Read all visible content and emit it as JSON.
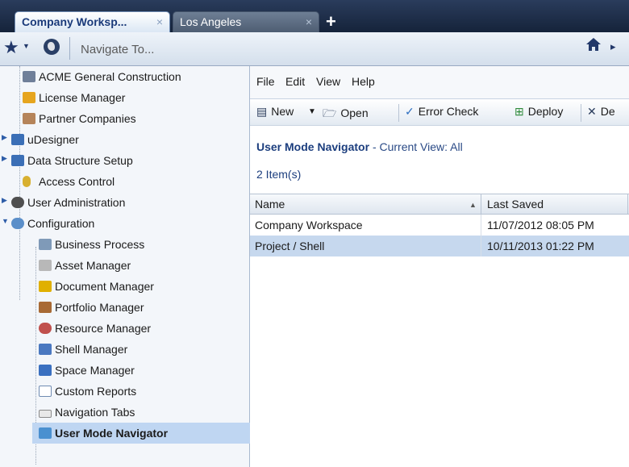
{
  "tabs": [
    {
      "label": "Company Worksp...",
      "close": "×",
      "active": true
    },
    {
      "label": "Los Angeles",
      "close": "×",
      "active": false
    }
  ],
  "add_tab": "+",
  "nav": {
    "placeholder": "Navigate To...",
    "home_arrow": "▸"
  },
  "sidebar": {
    "items": [
      {
        "label": "ACME General Construction",
        "icon": "building-icon",
        "color": "#6f7f99"
      },
      {
        "label": "License Manager",
        "icon": "license-icon",
        "color": "#e6a51e"
      },
      {
        "label": "Partner Companies",
        "icon": "partner-icon",
        "color": "#b5845a"
      },
      {
        "label": "uDesigner",
        "icon": "designer-icon",
        "color": "#3b6fb6"
      },
      {
        "label": "Data Structure Setup",
        "icon": "data-structure-icon",
        "color": "#3b6fb6"
      },
      {
        "label": "Access Control",
        "icon": "key-icon",
        "color": "#d8b030"
      },
      {
        "label": "User Administration",
        "icon": "users-icon",
        "color": "#4f4f4f"
      },
      {
        "label": "Configuration",
        "icon": "gears-icon",
        "color": "#5b8fc9"
      },
      {
        "label": "Business Process",
        "icon": "business-process-icon",
        "color": "#7f9ab8"
      },
      {
        "label": "Asset Manager",
        "icon": "asset-icon",
        "color": "#b8b8b8"
      },
      {
        "label": "Document Manager",
        "icon": "document-icon",
        "color": "#e0b000"
      },
      {
        "label": "Portfolio Manager",
        "icon": "briefcase-icon",
        "color": "#a86a35"
      },
      {
        "label": "Resource Manager",
        "icon": "resource-icon",
        "color": "#c0504d"
      },
      {
        "label": "Shell Manager",
        "icon": "shell-icon",
        "color": "#4a78c0"
      },
      {
        "label": "Space Manager",
        "icon": "space-icon",
        "color": "#3a70c0"
      },
      {
        "label": "Custom Reports",
        "icon": "reports-icon",
        "color": "#6f8bb2"
      },
      {
        "label": "Navigation Tabs",
        "icon": "tabs-icon",
        "color": "#e8e8e8"
      },
      {
        "label": "User Mode Navigator",
        "icon": "navigator-icon",
        "color": "#4a90d0"
      }
    ]
  },
  "menu": [
    "File",
    "Edit",
    "View",
    "Help"
  ],
  "toolbar": {
    "new": "New",
    "open": "Open",
    "error_check": "Error Check",
    "deploy": "Deploy",
    "de": "De"
  },
  "view": {
    "title": "User Mode Navigator",
    "current_view": "- Current View:  All",
    "count": "2  Item(s)"
  },
  "grid": {
    "columns": [
      "Name",
      "Last Saved"
    ],
    "sort_indicator": "▲",
    "rows": [
      {
        "name": "Company Workspace",
        "last_saved": "11/07/2012 08:05 PM"
      },
      {
        "name": "Project / Shell",
        "last_saved": "10/11/2013 01:22 PM"
      }
    ]
  }
}
